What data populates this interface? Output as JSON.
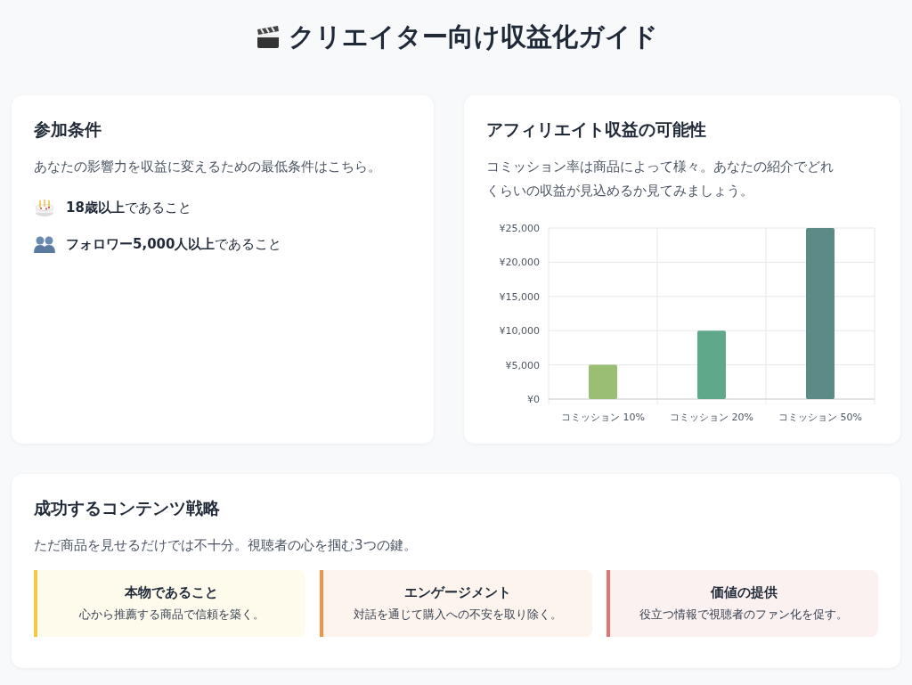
{
  "title": {
    "text": "クリエイター向け収益化ガイド"
  },
  "requirements": {
    "heading": "参加条件",
    "description": "あなたの影響力を収益に変えるための最低条件はこちら。",
    "items": [
      {
        "text": "**18歳以上**であること"
      },
      {
        "text": "**フォロワー5,000人以上**であること"
      }
    ]
  },
  "affiliate": {
    "heading": "アフィリエイト収益の可能性",
    "description": "コミッション率は商品によって様々。あなたの紹介でどれくらいの収益が見込めるか見てみましょう。",
    "chart_data": {
      "type": "bar",
      "grid": true,
      "series": [
        {
          "name": "コミッション 10%",
          "color": "#9bbf72",
          "values": [
            5000
          ]
        },
        {
          "name": "コミッション 20%",
          "color": "#5fa98a",
          "values": [
            10000
          ]
        },
        {
          "name": "コミッション 50%",
          "color": "#5b8a87",
          "values": [
            25000
          ]
        }
      ],
      "ylim": [
        0,
        25000
      ],
      "yticks": [
        {
          "value": 0,
          "label": "¥0"
        },
        {
          "value": 5000,
          "label": "¥5,000"
        },
        {
          "value": 10000,
          "label": "¥10,000"
        },
        {
          "value": 15000,
          "label": "¥15,000"
        },
        {
          "value": 20000,
          "label": "¥20,000"
        },
        {
          "value": 25000,
          "label": "¥25,000"
        }
      ]
    }
  },
  "strategy": {
    "heading": "成功するコンテンツ戦略",
    "description": "ただ商品を見せるだけでは不十分。視聴者の心を掴む3つの鍵。",
    "keys": [
      {
        "title": "本物であること",
        "text": "心から推薦する商品で信頼を築く。",
        "color": "#f5c842"
      },
      {
        "title": "エンゲージメント",
        "text": "対話を通じて購入への不安を取り除く。",
        "color": "#ef9547"
      },
      {
        "title": "価値の提供",
        "text": "役立つ情報で視聴者のファン化を促す。",
        "color": "#e57373"
      }
    ]
  }
}
